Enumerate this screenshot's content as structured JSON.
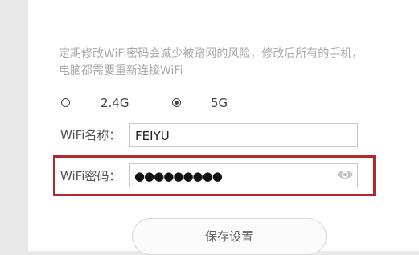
{
  "hint": {
    "line1": "定期修改WiFi密码会减少被蹭网的风险，修改后所有的手机，",
    "line2": "电脑都需要重新连接WiFi"
  },
  "band": {
    "options": [
      {
        "label": "2.4G",
        "selected": false
      },
      {
        "label": "5G",
        "selected": true
      }
    ]
  },
  "wifi_name": {
    "label": "WiFi名称：",
    "value": "FEIYU"
  },
  "wifi_password": {
    "label": "WiFi密码：",
    "masked_value": "●●●●●●●●●",
    "icon": "eye-icon"
  },
  "save_button": {
    "label": "保存设置"
  },
  "colors": {
    "highlight": "#b0282a",
    "hint_text": "#a9a9a9"
  }
}
